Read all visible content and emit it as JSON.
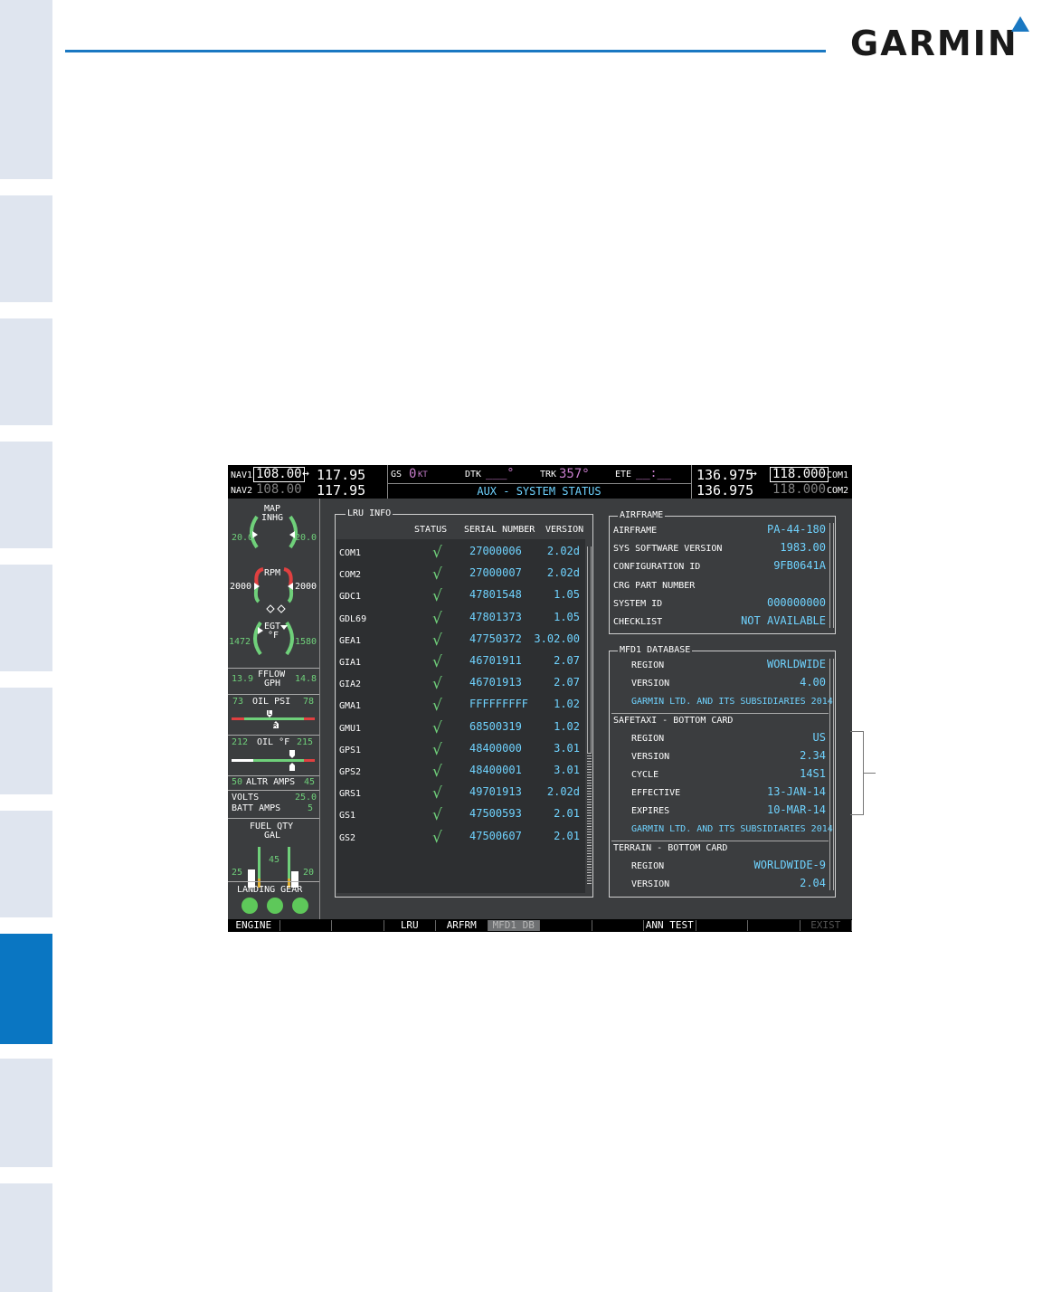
{
  "brand": {
    "name": "GARMIN"
  },
  "display": {
    "nav": {
      "nav1_label": "NAV1",
      "nav1_active": "108.00",
      "nav1_arrow": "↔",
      "nav1_standby": "117.95",
      "nav2_label": "NAV2",
      "nav2_active": "108.00",
      "nav2_standby": "117.95"
    },
    "nav_data": {
      "gs_label": "GS",
      "gs_value": "0",
      "gs_unit": "KT",
      "dtk_label": "DTK",
      "dtk_value": "___°",
      "trk_label": "TRK",
      "trk_value": "357°",
      "ete_label": "ETE",
      "ete_value": "__:__",
      "page_title": "AUX - SYSTEM STATUS"
    },
    "com": {
      "com1_standby": "136.975",
      "com1_arrow": "↔",
      "com1_active": "118.000",
      "com1_label": "COM1",
      "com2_standby": "136.975",
      "com2_active": "118.000",
      "com2_label": "COM2"
    },
    "engine": {
      "map_label": "MAP",
      "map_unit": "INHG",
      "map_left": "20.0",
      "map_right": "20.0",
      "rpm_label": "RPM",
      "rpm_left": "2000",
      "rpm_right": "2000",
      "egt_label": "EGT",
      "egt_unit": "°F",
      "egt_left": "1472",
      "egt_right": "1580",
      "fflow_left": "13.9",
      "fflow_label": "FFLOW",
      "fflow_unit": "GPH",
      "fflow_right": "14.8",
      "oilpsi_left": "73",
      "oilpsi_label": "OIL PSI",
      "oilpsi_right": "78",
      "oilf_left": "212",
      "oilf_label": "OIL °F",
      "oilf_right": "215",
      "altr_left": "50",
      "altr_label": "ALTR AMPS",
      "altr_right": "45",
      "volts_label": "VOLTS",
      "volts_value": "25.0",
      "batt_label": "BATT AMPS",
      "batt_value": "5",
      "fuel_label": "FUEL QTY",
      "fuel_unit": "GAL",
      "fuel_left": "25",
      "fuel_mid": "45",
      "fuel_right": "20",
      "gear_label": "LANDING GEAR",
      "marker_r": "R",
      "marker_l": "L"
    },
    "lru_info": {
      "title": "LRU INFO",
      "headers": {
        "status": "STATUS",
        "serial": "SERIAL NUMBER",
        "version": "VERSION"
      },
      "check": "√",
      "rows": [
        {
          "name": "COM1",
          "serial": "27000006",
          "version": "2.02d"
        },
        {
          "name": "COM2",
          "serial": "27000007",
          "version": "2.02d"
        },
        {
          "name": "GDC1",
          "serial": "47801548",
          "version": "1.05"
        },
        {
          "name": "GDL69",
          "serial": "47801373",
          "version": "1.05"
        },
        {
          "name": "GEA1",
          "serial": "47750372",
          "version": "3.02.00"
        },
        {
          "name": "GIA1",
          "serial": "46701911",
          "version": "2.07"
        },
        {
          "name": "GIA2",
          "serial": "46701913",
          "version": "2.07"
        },
        {
          "name": "GMA1",
          "serial": "FFFFFFFFF",
          "version": "1.02"
        },
        {
          "name": "GMU1",
          "serial": "68500319",
          "version": "1.02"
        },
        {
          "name": "GPS1",
          "serial": "48400000",
          "version": "3.01"
        },
        {
          "name": "GPS2",
          "serial": "48400001",
          "version": "3.01"
        },
        {
          "name": "GRS1",
          "serial": "49701913",
          "version": "2.02d"
        },
        {
          "name": "GS1",
          "serial": "47500593",
          "version": "2.01"
        },
        {
          "name": "GS2",
          "serial": "47500607",
          "version": "2.01"
        }
      ]
    },
    "airframe": {
      "title": "AIRFRAME",
      "rows": [
        {
          "label": "AIRFRAME",
          "value": "PA-44-180"
        },
        {
          "label": "SYS SOFTWARE VERSION",
          "value": "1983.00"
        },
        {
          "label": "CONFIGURATION ID",
          "value": "9FB0641A"
        },
        {
          "label": "CRG PART NUMBER",
          "value": ""
        },
        {
          "label": "SYSTEM ID",
          "value": "000000000"
        },
        {
          "label": "CHECKLIST",
          "value": "NOT AVAILABLE"
        }
      ]
    },
    "mfd_db": {
      "title": "MFD1 DATABASE",
      "region_label": "REGION",
      "region_value": "WORLDWIDE",
      "version_label": "VERSION",
      "version_value": "4.00",
      "copyright1": "GARMIN LTD. AND ITS SUBSIDIARIES 2014",
      "safetaxi_title": "SAFETAXI - BOTTOM CARD",
      "st_region_label": "REGION",
      "st_region_value": "US",
      "st_version_label": "VERSION",
      "st_version_value": "2.34",
      "st_cycle_label": "CYCLE",
      "st_cycle_value": "14S1",
      "st_effective_label": "EFFECTIVE",
      "st_effective_value": "13-JAN-14",
      "st_expires_label": "EXPIRES",
      "st_expires_value": "10-MAR-14",
      "copyright2": "GARMIN LTD. AND ITS SUBSIDIARIES 2014",
      "terrain_title": "TERRAIN - BOTTOM CARD",
      "tr_region_label": "REGION",
      "tr_region_value": "WORLDWIDE-9",
      "tr_version_label": "VERSION",
      "tr_version_value": "2.04"
    },
    "softkeys": [
      "ENGINE",
      "",
      "",
      "LRU",
      "ARFRM",
      "MFD1 DB",
      "",
      "",
      "ANN TEST",
      "",
      "",
      "EXIST"
    ]
  },
  "colors": {
    "accent": "#0a76c2",
    "cyan": "#6fd3ff",
    "magenta": "#c77dcc",
    "green": "#6fd07a"
  }
}
